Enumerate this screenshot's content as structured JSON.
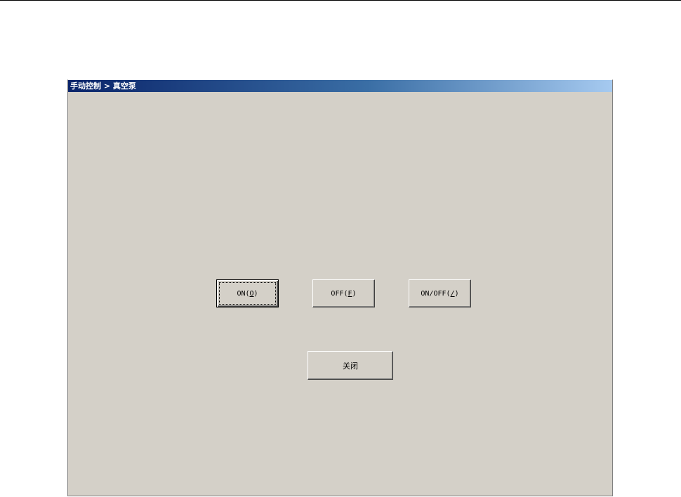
{
  "window": {
    "title": "手动控制 > 真空泵"
  },
  "buttons": {
    "on": {
      "prefix": "ON(",
      "accel": "O",
      "suffix": ")"
    },
    "off": {
      "prefix": "OFF(",
      "accel": "F",
      "suffix": ")"
    },
    "onoff": {
      "prefix": "ON/OFF(",
      "accel": "/",
      "suffix": ")"
    },
    "close": {
      "label": "关闭"
    }
  },
  "colors": {
    "dialog_bg": "#d4d0c8",
    "titlebar_start": "#0a246a",
    "titlebar_end": "#a6caf0"
  }
}
